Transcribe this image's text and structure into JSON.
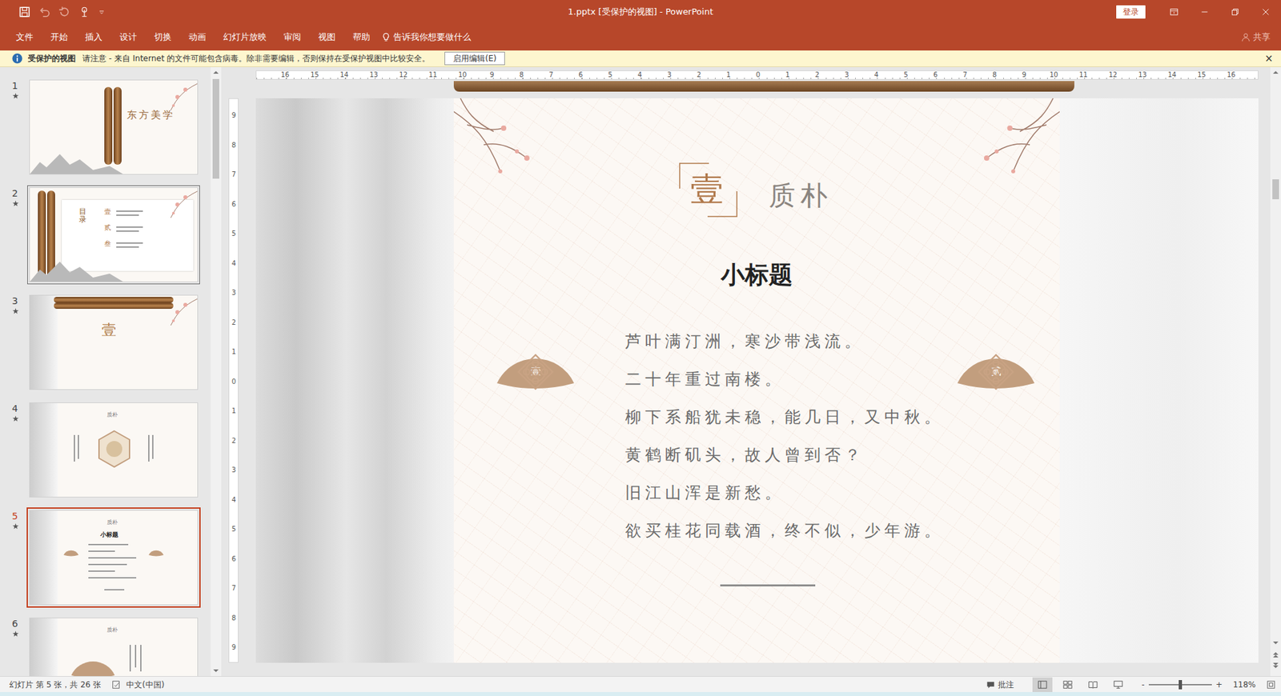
{
  "window": {
    "title": "1.pptx [受保护的视图] - PowerPoint",
    "sign_in": "登录"
  },
  "ribbon": {
    "tabs": [
      {
        "label": "文件",
        "selected": false
      },
      {
        "label": "开始",
        "selected": false
      },
      {
        "label": "插入",
        "selected": false
      },
      {
        "label": "设计",
        "selected": false
      },
      {
        "label": "切换",
        "selected": false
      },
      {
        "label": "动画",
        "selected": false
      },
      {
        "label": "幻灯片放映",
        "selected": false
      },
      {
        "label": "审阅",
        "selected": false
      },
      {
        "label": "视图",
        "selected": false
      },
      {
        "label": "帮助",
        "selected": false
      }
    ],
    "tell_me": "告诉我你想要做什么",
    "share": "共享"
  },
  "protected_view": {
    "title": "受保护的视图",
    "message": "请注意 - 来自 Internet 的文件可能包含病毒。除非需要编辑，否则保持在受保护视图中比较安全。",
    "button": "启用编辑(E)",
    "close": "×"
  },
  "thumbnails": [
    {
      "number": "1",
      "kind": "cover",
      "selected": false,
      "outlined": false,
      "texts": [
        "东方美学"
      ]
    },
    {
      "number": "2",
      "kind": "contents",
      "selected": false,
      "outlined": true,
      "texts": [
        "目录",
        "壹",
        "贰",
        "叁"
      ]
    },
    {
      "number": "3",
      "kind": "section",
      "selected": false,
      "outlined": false,
      "texts": [
        "壹"
      ]
    },
    {
      "number": "4",
      "kind": "hexagon",
      "selected": false,
      "outlined": false,
      "texts": [
        "质朴"
      ]
    },
    {
      "number": "5",
      "kind": "text",
      "selected": true,
      "outlined": false,
      "texts": [
        "质朴",
        "小标题"
      ]
    },
    {
      "number": "6",
      "kind": "fan",
      "selected": false,
      "outlined": false,
      "texts": [
        "质朴"
      ]
    }
  ],
  "rulers": {
    "horizontal": [
      "16",
      "15",
      "14",
      "13",
      "12",
      "11",
      "10",
      "9",
      "8",
      "7",
      "6",
      "5",
      "4",
      "3",
      "2",
      "1",
      "0",
      "1",
      "2",
      "3",
      "4",
      "5",
      "6",
      "7",
      "8",
      "9",
      "10",
      "11",
      "12",
      "13",
      "14",
      "15",
      "16"
    ],
    "vertical": [
      "9",
      "8",
      "7",
      "6",
      "5",
      "4",
      "3",
      "2",
      "1",
      "0",
      "1",
      "2",
      "3",
      "4",
      "5",
      "6",
      "7",
      "8",
      "9"
    ]
  },
  "slide": {
    "number": "壹",
    "title": "质朴",
    "subtitle": "小标题",
    "lines": [
      "芦叶满汀洲，寒沙带浅流。",
      "二十年重过南楼。",
      "柳下系船犹未稳，能几日，又中秋。",
      "黄鹤断矶头，故人曾到否？",
      "旧江山浑是新愁。",
      "欲买桂花同载酒，终不似，少年游。"
    ],
    "fans": [
      {
        "label": "壹"
      },
      {
        "label": "贰"
      }
    ]
  },
  "status_bar": {
    "slide_info": "幻灯片 第 5 张，共 26 张",
    "language": "中文(中国)",
    "comments": "批注",
    "views": [
      {
        "kind": "normal",
        "selected": true
      },
      {
        "kind": "sorter",
        "selected": false
      },
      {
        "kind": "reading",
        "selected": false
      },
      {
        "kind": "slideshow",
        "selected": false
      }
    ],
    "zoom_out": "-",
    "zoom_in": "+",
    "zoom_level": 0.5,
    "zoom": "118%"
  }
}
